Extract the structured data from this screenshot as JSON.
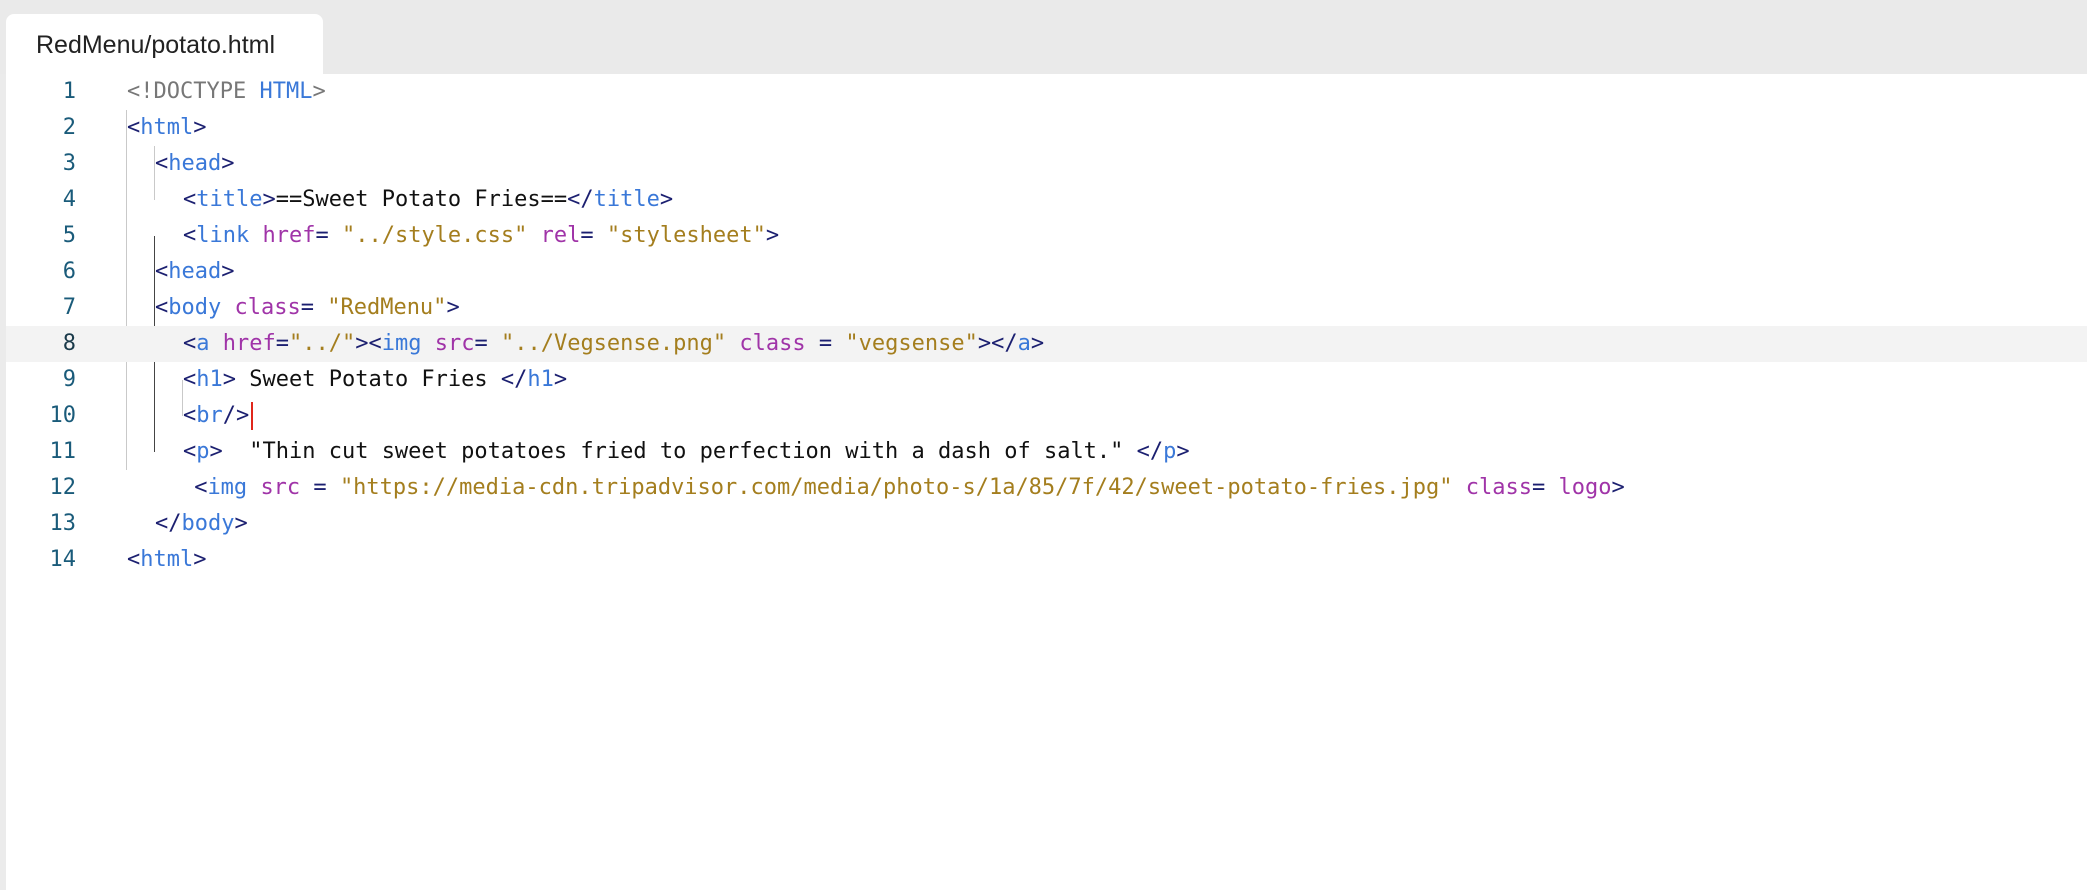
{
  "editor": {
    "tab_title": "RedMenu/potato.html",
    "active_line": 8,
    "lines": [
      {
        "num": "1",
        "indent": 0,
        "tokens": [
          {
            "t": "doc",
            "v": "<!DOCTYPE "
          },
          {
            "t": "tag",
            "v": "HTML"
          },
          {
            "t": "doc",
            "v": ">"
          }
        ]
      },
      {
        "num": "2",
        "indent": 0,
        "tokens": [
          {
            "t": "ang",
            "v": "<"
          },
          {
            "t": "tag",
            "v": "html"
          },
          {
            "t": "ang",
            "v": ">"
          }
        ]
      },
      {
        "num": "3",
        "indent": 1,
        "tokens": [
          {
            "t": "ang",
            "v": "<"
          },
          {
            "t": "tag",
            "v": "head"
          },
          {
            "t": "ang",
            "v": ">"
          }
        ]
      },
      {
        "num": "4",
        "indent": 2,
        "tokens": [
          {
            "t": "ang",
            "v": "<"
          },
          {
            "t": "tag",
            "v": "title"
          },
          {
            "t": "ang",
            "v": ">"
          },
          {
            "t": "txt",
            "v": "==Sweet Potato Fries=="
          },
          {
            "t": "ang",
            "v": "</"
          },
          {
            "t": "tag",
            "v": "title"
          },
          {
            "t": "ang",
            "v": ">"
          }
        ]
      },
      {
        "num": "5",
        "indent": 2,
        "tokens": [
          {
            "t": "ang",
            "v": "<"
          },
          {
            "t": "tag",
            "v": "link"
          },
          {
            "t": "txt",
            "v": " "
          },
          {
            "t": "attr",
            "v": "href"
          },
          {
            "t": "ang",
            "v": "= "
          },
          {
            "t": "str",
            "v": "\"../style.css\""
          },
          {
            "t": "txt",
            "v": " "
          },
          {
            "t": "attr",
            "v": "rel"
          },
          {
            "t": "ang",
            "v": "= "
          },
          {
            "t": "str",
            "v": "\"stylesheet\""
          },
          {
            "t": "ang",
            "v": ">"
          }
        ]
      },
      {
        "num": "6",
        "indent": 1,
        "tokens": [
          {
            "t": "ang",
            "v": "<"
          },
          {
            "t": "tag",
            "v": "head"
          },
          {
            "t": "ang",
            "v": ">"
          }
        ]
      },
      {
        "num": "7",
        "indent": 1,
        "tokens": [
          {
            "t": "ang",
            "v": "<"
          },
          {
            "t": "tag",
            "v": "body"
          },
          {
            "t": "txt",
            "v": " "
          },
          {
            "t": "attr",
            "v": "class"
          },
          {
            "t": "ang",
            "v": "= "
          },
          {
            "t": "str",
            "v": "\"RedMenu\""
          },
          {
            "t": "ang",
            "v": ">"
          }
        ]
      },
      {
        "num": "8",
        "indent": 2,
        "tokens": [
          {
            "t": "ang",
            "v": "<"
          },
          {
            "t": "tag",
            "v": "a"
          },
          {
            "t": "txt",
            "v": " "
          },
          {
            "t": "attr",
            "v": "href"
          },
          {
            "t": "ang",
            "v": "="
          },
          {
            "t": "str",
            "v": "\"../\""
          },
          {
            "t": "ang",
            "v": "><"
          },
          {
            "t": "tag",
            "v": "img"
          },
          {
            "t": "txt",
            "v": " "
          },
          {
            "t": "attr",
            "v": "src"
          },
          {
            "t": "ang",
            "v": "= "
          },
          {
            "t": "str",
            "v": "\"../Vegsense.png\""
          },
          {
            "t": "txt",
            "v": " "
          },
          {
            "t": "attr",
            "v": "class"
          },
          {
            "t": "ang",
            "v": " = "
          },
          {
            "t": "str",
            "v": "\"vegsense\""
          },
          {
            "t": "ang",
            "v": "></"
          },
          {
            "t": "tag",
            "v": "a"
          },
          {
            "t": "ang",
            "v": ">"
          }
        ]
      },
      {
        "num": "9",
        "indent": 2,
        "tokens": [
          {
            "t": "ang",
            "v": "<"
          },
          {
            "t": "tag",
            "v": "h1"
          },
          {
            "t": "ang",
            "v": ">"
          },
          {
            "t": "txt",
            "v": " Sweet Potato Fries "
          },
          {
            "t": "ang",
            "v": "</"
          },
          {
            "t": "tag",
            "v": "h1"
          },
          {
            "t": "ang",
            "v": ">"
          }
        ]
      },
      {
        "num": "10",
        "indent": 2,
        "tokens": [
          {
            "t": "ang",
            "v": "<"
          },
          {
            "t": "tag",
            "v": "br"
          },
          {
            "t": "ang",
            "v": "/>"
          }
        ]
      },
      {
        "num": "11",
        "indent": 2,
        "tokens": [
          {
            "t": "ang",
            "v": "<"
          },
          {
            "t": "tag",
            "v": "p"
          },
          {
            "t": "ang",
            "v": ">"
          },
          {
            "t": "txt",
            "v": "  \"Thin cut sweet potatoes fried to perfection with a dash of salt.\" "
          },
          {
            "t": "ang",
            "v": "</"
          },
          {
            "t": "tag",
            "v": "p"
          },
          {
            "t": "ang",
            "v": ">"
          }
        ]
      },
      {
        "num": "12",
        "indent": 2.4,
        "tokens": [
          {
            "t": "ang",
            "v": "<"
          },
          {
            "t": "tag",
            "v": "img"
          },
          {
            "t": "txt",
            "v": " "
          },
          {
            "t": "attr",
            "v": "src"
          },
          {
            "t": "ang",
            "v": " = "
          },
          {
            "t": "str",
            "v": "\"https://media-cdn.tripadvisor.com/media/photo-s/1a/85/7f/42/sweet-potato-fries.jpg\""
          },
          {
            "t": "txt",
            "v": " "
          },
          {
            "t": "attr",
            "v": "class"
          },
          {
            "t": "ang",
            "v": "= "
          },
          {
            "t": "attr",
            "v": "logo"
          },
          {
            "t": "ang",
            "v": ">"
          }
        ]
      },
      {
        "num": "13",
        "indent": 1,
        "tokens": [
          {
            "t": "ang",
            "v": "</"
          },
          {
            "t": "tag",
            "v": "body"
          },
          {
            "t": "ang",
            "v": ">"
          }
        ]
      },
      {
        "num": "14",
        "indent": 0,
        "tokens": [
          {
            "t": "ang",
            "v": "<"
          },
          {
            "t": "tag",
            "v": "html"
          },
          {
            "t": "ang",
            "v": ">"
          }
        ]
      }
    ]
  }
}
